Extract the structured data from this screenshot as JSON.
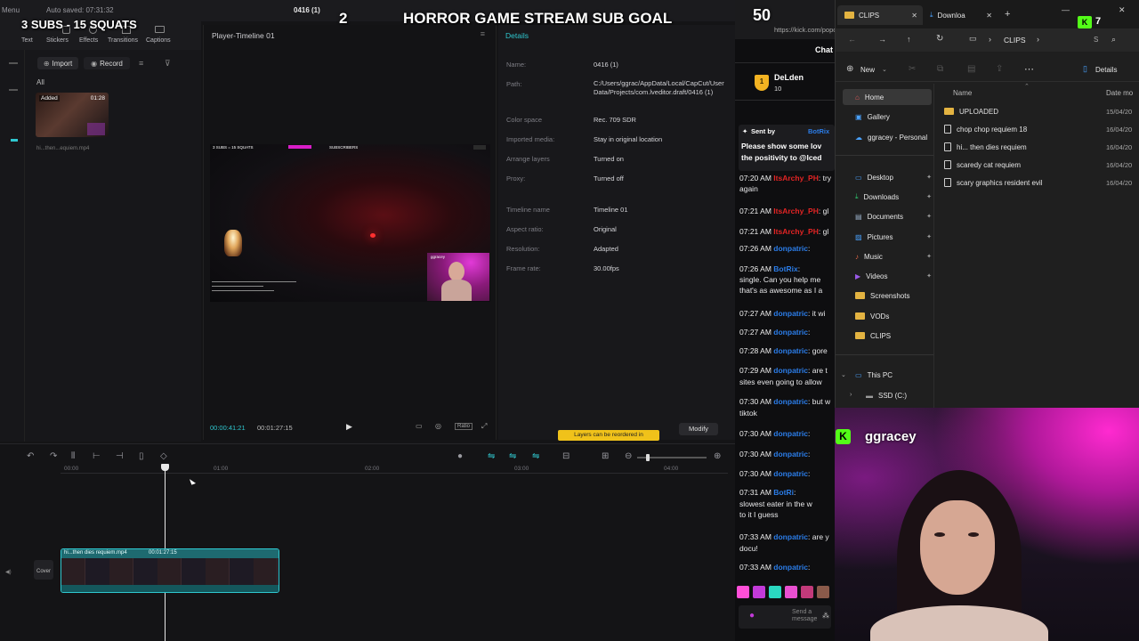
{
  "stream_overlay": {
    "sub_goal_text": "3 SUBS - 15 SQUATS",
    "sub_goal_count": "2",
    "stream_title": "HORROR GAME STREAM SUB GOAL",
    "top_right_count": "50",
    "top_right_badge": "7"
  },
  "capcut": {
    "menu_label": "Menu",
    "autosave": "Auto saved: 07:31:32",
    "project_name": "0416 (1)",
    "tools": [
      "Text",
      "Stickers",
      "Effects",
      "Transitions",
      "Captions"
    ],
    "import_label": "Import",
    "record_label": "Record",
    "filter_all": "All",
    "media_item": {
      "badge": "Added",
      "duration": "01:28",
      "name": "hi...then...equiem.mp4"
    },
    "player": {
      "title": "Player-Timeline 01",
      "current_time": "00:00:41:21",
      "total_time": "00:01:27:15",
      "preview_overlay_left": "3 SUBS = 15 SQUATS",
      "preview_overlay_mid": "SUBSCRIBERS",
      "preview_webcam_name": "ggracey"
    },
    "details": {
      "title": "Details",
      "rows": [
        {
          "label": "Name:",
          "value": "0416 (1)"
        },
        {
          "label": "Path:",
          "value": "C:/Users/ggrac/AppData/Local/CapCut/User Data/Projects/com.lveditor.draft/0416 (1)"
        },
        {
          "label": "Color space",
          "value": "Rec. 709 SDR"
        },
        {
          "label": "Imported media:",
          "value": "Stay in original location"
        },
        {
          "label": "Arrange layers",
          "value": "Turned on"
        },
        {
          "label": "Proxy:",
          "value": "Turned off"
        },
        {
          "label": "Timeline name",
          "value": "Timeline 01"
        },
        {
          "label": "Aspect ratio:",
          "value": "Original"
        },
        {
          "label": "Resolution:",
          "value": "Adapted"
        },
        {
          "label": "Frame rate:",
          "value": "30.00fps"
        }
      ],
      "tooltip": "Layers can be reordered in",
      "modify_label": "Modify"
    },
    "timeline": {
      "ruler": [
        "00:00",
        "01:00",
        "02:00",
        "03:00",
        "04:00"
      ],
      "clip_name": "hi...then dies requiem.mp4",
      "clip_duration": "00:01:27:15",
      "cover_label": "Cover"
    }
  },
  "chat": {
    "header": "Chat",
    "address": "https://kick.com/popo",
    "leader": {
      "name": "DeLden",
      "count": "10"
    },
    "pinned": {
      "sent_by_label": "Sent by",
      "sender": "BotRix",
      "text_1": "Please show some lov",
      "text_2": "the positivity to @Iced"
    },
    "messages": [
      {
        "time": "07:20 AM",
        "user": "ItsArchy_PH",
        "user_color": "#e22424",
        "text": "try"
      },
      {
        "time": "",
        "user": "",
        "user_color": "#e8e8ea",
        "text": "again"
      },
      {
        "time": "07:21 AM",
        "user": "ItsArchy_PH",
        "user_color": "#e22424",
        "text": "gl"
      },
      {
        "time": "07:21 AM",
        "user": "ItsArchy_PH",
        "user_color": "#e22424",
        "text": "gl"
      },
      {
        "time": "07:26 AM",
        "user": "donpatric",
        "user_color": "#2b7de9",
        "text": ""
      },
      {
        "time": "07:26 AM",
        "user": "BotRix",
        "user_color": "#2b7de9",
        "text": ""
      },
      {
        "time": "",
        "user": "",
        "user_color": "#e8e8ea",
        "text": "single. Can you help me"
      },
      {
        "time": "",
        "user": "",
        "user_color": "#e8e8ea",
        "text": "that's as awesome as I a"
      },
      {
        "time": "07:27 AM",
        "user": "donpatric",
        "user_color": "#2b7de9",
        "text": "it wi"
      },
      {
        "time": "07:27 AM",
        "user": "donpatric",
        "user_color": "#2b7de9",
        "text": ""
      },
      {
        "time": "07:28 AM",
        "user": "donpatric",
        "user_color": "#2b7de9",
        "text": "gore"
      },
      {
        "time": "07:29 AM",
        "user": "donpatric",
        "user_color": "#2b7de9",
        "text": "are t"
      },
      {
        "time": "",
        "user": "",
        "user_color": "#e8e8ea",
        "text": "sites even going to allow"
      },
      {
        "time": "07:30 AM",
        "user": "donpatric",
        "user_color": "#2b7de9",
        "text": "but w"
      },
      {
        "time": "",
        "user": "",
        "user_color": "#e8e8ea",
        "text": "tiktok"
      },
      {
        "time": "07:30 AM",
        "user": "donpatric",
        "user_color": "#2b7de9",
        "text": ""
      },
      {
        "time": "07:30 AM",
        "user": "donpatric",
        "user_color": "#2b7de9",
        "text": ""
      },
      {
        "time": "07:30 AM",
        "user": "donpatric",
        "user_color": "#2b7de9",
        "text": ""
      },
      {
        "time": "07:31 AM",
        "user": "BotRi",
        "user_color": "#2b7de9",
        "text": ""
      },
      {
        "time": "",
        "user": "",
        "user_color": "#e8e8ea",
        "text": "slowest eater in the w"
      },
      {
        "time": "",
        "user": "",
        "user_color": "#e8e8ea",
        "text": "to it I guess"
      },
      {
        "time": "07:33 AM",
        "user": "donpatric",
        "user_color": "#2b7de9",
        "text": "are y"
      },
      {
        "time": "",
        "user": "",
        "user_color": "#e8e8ea",
        "text": "docu!"
      },
      {
        "time": "07:33 AM",
        "user": "donpatric",
        "user_color": "#2b7de9",
        "text": ""
      }
    ],
    "input_placeholder": "Send a message"
  },
  "explorer": {
    "tabs": [
      {
        "label": "CLIPS"
      },
      {
        "label": "Downloa"
      }
    ],
    "breadcrumb": [
      "CLIPS"
    ],
    "search_placeholder": "S",
    "new_label": "New",
    "details_label": "Details",
    "col_name": "Name",
    "col_date": "Date mo",
    "nav": [
      {
        "label": "Home",
        "icon": "home-icon"
      },
      {
        "label": "Gallery",
        "icon": "gallery-icon"
      },
      {
        "label": "ggracey - Personal",
        "icon": "cloud-icon"
      },
      {
        "label": "Desktop",
        "icon": "desktop-icon"
      },
      {
        "label": "Downloads",
        "icon": "download-icon"
      },
      {
        "label": "Documents",
        "icon": "document-icon"
      },
      {
        "label": "Pictures",
        "icon": "picture-icon"
      },
      {
        "label": "Music",
        "icon": "music-icon"
      },
      {
        "label": "Videos",
        "icon": "video-icon"
      },
      {
        "label": "Screenshots",
        "icon": "folder-icon"
      },
      {
        "label": "VODs",
        "icon": "folder-icon"
      },
      {
        "label": "CLIPS",
        "icon": "folder-icon"
      },
      {
        "label": "This PC",
        "icon": "pc-icon"
      },
      {
        "label": "SSD (C:)",
        "icon": "drive-icon"
      }
    ],
    "files": [
      {
        "name": "UPLOADED",
        "type": "folder",
        "date": "15/04/20"
      },
      {
        "name": "chop chop requiem 18",
        "type": "video",
        "date": "16/04/20"
      },
      {
        "name": "hi... then dies requiem",
        "type": "video",
        "date": "16/04/20"
      },
      {
        "name": "scaredy cat requiem",
        "type": "video",
        "date": "16/04/20"
      },
      {
        "name": "scary graphics resident evil",
        "type": "video",
        "date": "16/04/20"
      }
    ]
  },
  "webcam": {
    "name": "ggracey"
  },
  "colors": {
    "accent_teal": "#2fc7cf",
    "kick_green": "#53fc18",
    "explorer_folder": "#e3b341",
    "chat_user_blue": "#2b7de9",
    "chat_user_red": "#e22424"
  }
}
